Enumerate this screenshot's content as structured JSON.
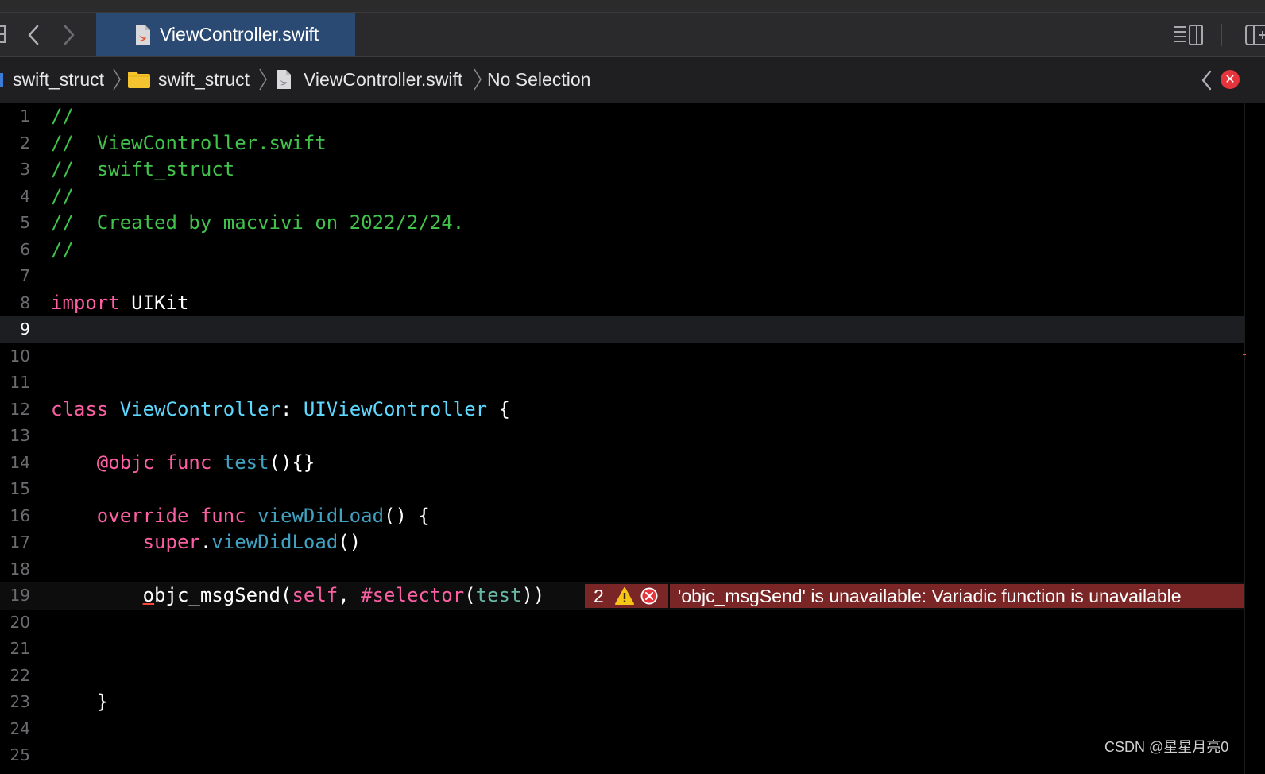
{
  "tab": {
    "label": "ViewController.swift"
  },
  "jumpbar": {
    "crumbs": [
      "swift_struct",
      "swift_struct",
      "ViewController.swift",
      "No Selection"
    ]
  },
  "editor": {
    "line_numbers": [
      "1",
      "2",
      "3",
      "4",
      "5",
      "6",
      "7",
      "8",
      "9",
      "10",
      "11",
      "12",
      "13",
      "14",
      "15",
      "16",
      "17",
      "18",
      "19",
      "20",
      "21",
      "22",
      "23",
      "24",
      "25"
    ],
    "current_line": "9",
    "tokens": {
      "l1": "//",
      "l2": "//  ViewController.swift",
      "l3": "//  swift_struct",
      "l4": "//",
      "l5": "//  Created by macvivi on 2022/2/24.",
      "l6": "//",
      "l8_kw": "import",
      "l8_rest": " UIKit",
      "l12_kw": "class",
      "l12_name": " ViewController",
      "l12_colon": ": ",
      "l12_super": "UIViewController",
      "l12_brace": " {",
      "l14_attr": "@objc",
      "l14_func": " func",
      "l14_name": " test",
      "l14_rest": "(){}",
      "l16_override": "override",
      "l16_func": " func",
      "l16_name": " viewDidLoad",
      "l16_rest": "() {",
      "l17_super": "super",
      "l17_dot": ".",
      "l17_name": "viewDidLoad",
      "l17_rest": "()",
      "l19_o": "o",
      "l19_fn": "bjc_msgSend(",
      "l19_self": "self",
      "l19_comma": ", ",
      "l19_sel": "#selector",
      "l19_paren": "(",
      "l19_test": "test",
      "l19_close": "))",
      "l23": "}"
    }
  },
  "diagnostic": {
    "count": "2",
    "message": "'objc_msgSend' is unavailable: Variadic function is unavailable",
    "warning_icon": "warning-triangle-icon",
    "error_icon": "error-circle-icon"
  },
  "watermark": "CSDN @星星月亮0",
  "colors": {
    "comment": "#41c34b",
    "keyword": "#fc5fa3",
    "type": "#5dd8ff",
    "function": "#41a1c0",
    "tab_active": "#2a4a74",
    "error_bg": "#7a2526"
  }
}
